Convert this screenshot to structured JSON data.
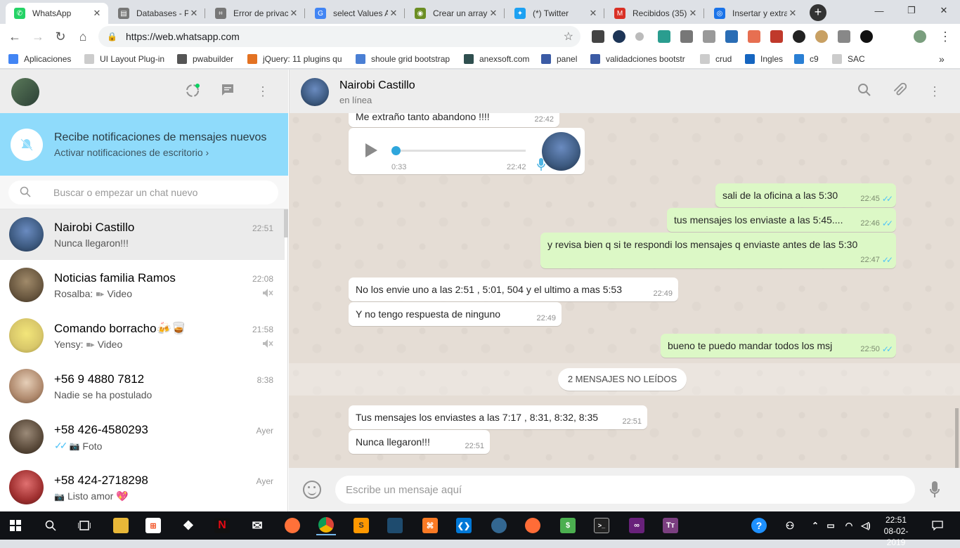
{
  "browser": {
    "tabs": [
      {
        "title": "WhatsApp",
        "color": "#25d366",
        "glyph": "✆",
        "active": true
      },
      {
        "title": "Databases - Pr",
        "color": "#777777",
        "glyph": "▤"
      },
      {
        "title": "Error de privac",
        "color": "#777777",
        "glyph": "⌗"
      },
      {
        "title": "select Values A",
        "color": "#4285f4",
        "glyph": "G"
      },
      {
        "title": "Crear un array",
        "color": "#6b8e23",
        "glyph": "◉"
      },
      {
        "title": "(*) Twitter",
        "color": "#1da1f2",
        "glyph": "✦"
      },
      {
        "title": "Recibidos (35)",
        "color": "#d93025",
        "glyph": "M"
      },
      {
        "title": "Insertar y extra",
        "color": "#1a73e8",
        "glyph": "◎"
      }
    ],
    "url": "https://web.whatsapp.com",
    "bookmarks": [
      {
        "label": "Aplicaciones",
        "color": "#4285f4"
      },
      {
        "label": "UI Layout Plug-in",
        "color": "#cccccc"
      },
      {
        "label": "pwabuilder",
        "color": "#555555"
      },
      {
        "label": "jQuery: 11 plugins qu",
        "color": "#e37222"
      },
      {
        "label": "shoule grid bootstrap",
        "color": "#4a7fd4"
      },
      {
        "label": "anexsoft.com",
        "color": "#2f4f4f"
      },
      {
        "label": "panel",
        "color": "#3b5ba5"
      },
      {
        "label": "validadciones bootstr",
        "color": "#3b5ba5"
      },
      {
        "label": "crud",
        "color": "#cccccc"
      },
      {
        "label": "Ingles",
        "color": "#1565c0"
      },
      {
        "label": "c9",
        "color": "#2a7fd4"
      },
      {
        "label": "SAC",
        "color": "#cccccc"
      }
    ]
  },
  "sidebar": {
    "notification": {
      "title": "Recibe notificaciones de mensajes nuevos",
      "subtitle": "Activar notificaciones de escritorio ›"
    },
    "search": {
      "placeholder": "Buscar o empezar un chat nuevo"
    },
    "chats": [
      {
        "name": "Nairobi Castillo",
        "time": "22:51",
        "preview": "Nunca llegaron!!!",
        "active": true,
        "muted": false,
        "avatar_color": "#3d5a80",
        "prefix": "",
        "media": "",
        "suffix_emoji": ""
      },
      {
        "name": "Noticias familia Ramos",
        "time": "22:08",
        "preview": "Video",
        "prefix": "Rosalba:",
        "media": "video-icon",
        "muted": true,
        "avatar_color": "#6a5840",
        "suffix_emoji": ""
      },
      {
        "name": "Comando borracho",
        "time": "21:58",
        "preview": "Video",
        "prefix": "Yensy:",
        "media": "video-icon",
        "muted": true,
        "avatar_color": "#d8c76a",
        "suffix_emoji": "🍻🥃"
      },
      {
        "name": "+56 9 4880 7812",
        "time": "8:38",
        "preview": "Nadie se ha postulado",
        "prefix": "",
        "media": "",
        "muted": false,
        "avatar_color": "#b08a6e",
        "suffix_emoji": ""
      },
      {
        "name": "+58 426-4580293",
        "time": "Ayer",
        "preview": "Foto",
        "prefix": "",
        "media": "camera-icon",
        "ticks": true,
        "muted": false,
        "avatar_color": "#5a4a3a",
        "suffix_emoji": ""
      },
      {
        "name": "+58 424-2718298",
        "time": "Ayer",
        "preview": "Listo amor 💖",
        "prefix": "",
        "media": "camera-icon",
        "muted": false,
        "avatar_color": "#a03030",
        "suffix_emoji": ""
      }
    ]
  },
  "conversation": {
    "contact_name": "Nairobi Castillo",
    "status": "en línea",
    "voice_note": {
      "duration": "0:33",
      "time": "22:42"
    },
    "partial_message": {
      "text": "Me extraño tanto abandono !!!!",
      "time": "22:42"
    },
    "messages": [
      {
        "dir": "out",
        "text": "sali de la oficina a las 5:30",
        "time": "22:45"
      },
      {
        "dir": "out",
        "text": "tus mensajes los enviaste a las 5:45....",
        "time": "22:46"
      },
      {
        "dir": "out",
        "text": "y revisa bien q si te respondi los mensajes q enviaste antes de las 5:30",
        "time": "22:47"
      },
      {
        "dir": "in",
        "text": "No los envie uno a las 2:51 , 5:01, 504 y el ultimo a mas 5:53",
        "time": "22:49"
      },
      {
        "dir": "in",
        "text": "Y no tengo respuesta de ninguno",
        "time": "22:49"
      },
      {
        "dir": "out",
        "text": "bueno te puedo mandar todos los msj",
        "time": "22:50"
      },
      {
        "dir": "in",
        "text": "Tus mensajes los enviastes a las 7:17 , 8:31, 8:32, 8:35",
        "time": "22:51"
      },
      {
        "dir": "in",
        "text": "Nunca llegaron!!!",
        "time": "22:51"
      }
    ],
    "unread_label": "2 MENSAJES NO LEÍDOS",
    "composer_placeholder": "Escribe un mensaje aquí"
  },
  "taskbar": {
    "time": "22:51",
    "date": "08-02-2019"
  }
}
